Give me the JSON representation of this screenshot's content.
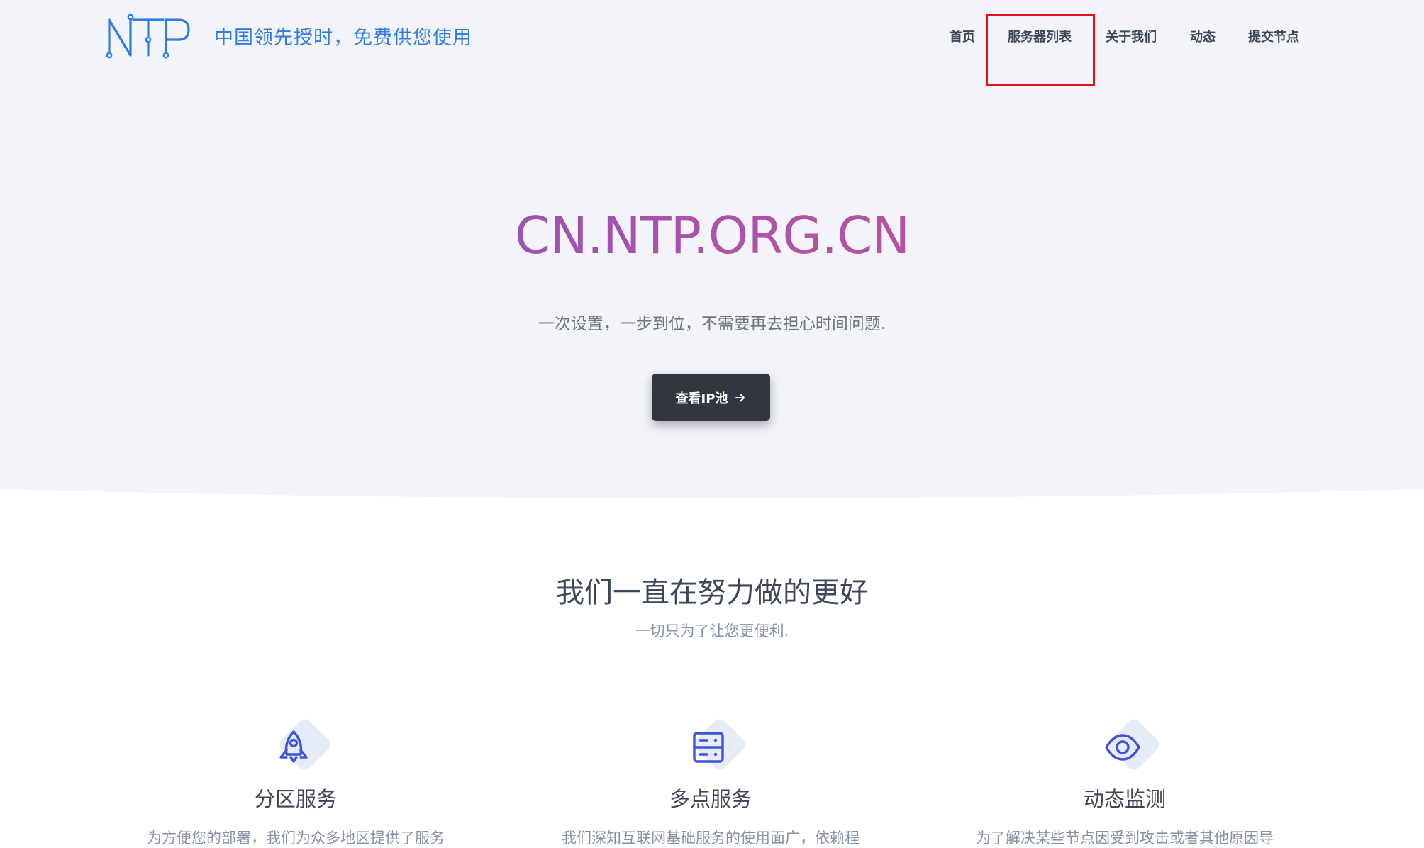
{
  "header": {
    "logo_text": "NTP",
    "tagline": "中国领先授时，免费供您使用",
    "nav": [
      {
        "label": "首页"
      },
      {
        "label": "服务器列表"
      },
      {
        "label": "关于我们"
      },
      {
        "label": "动态"
      },
      {
        "label": "提交节点"
      }
    ]
  },
  "hero": {
    "title": "CN.NTP.ORG.CN",
    "subtitle": "一次设置，一步到位，不需要再去担心时间问题.",
    "cta_label": "查看IP池"
  },
  "section": {
    "title": "我们一直在努力做的更好",
    "subtitle": "一切只为了让您更便利."
  },
  "features": [
    {
      "icon": "rocket-icon",
      "title": "分区服务",
      "desc": "为方便您的部署，我们为众多地区提供了服务"
    },
    {
      "icon": "server-icon",
      "title": "多点服务",
      "desc": "我们深知互联网基础服务的使用面广，依赖程"
    },
    {
      "icon": "eye-icon",
      "title": "动态监测",
      "desc": "为了解决某些节点因受到攻击或者其他原因导"
    }
  ],
  "colors": {
    "accent": "#2f7de1",
    "highlight_box": "#e0111b",
    "button": "#313640",
    "icon": "#3f51d8"
  }
}
